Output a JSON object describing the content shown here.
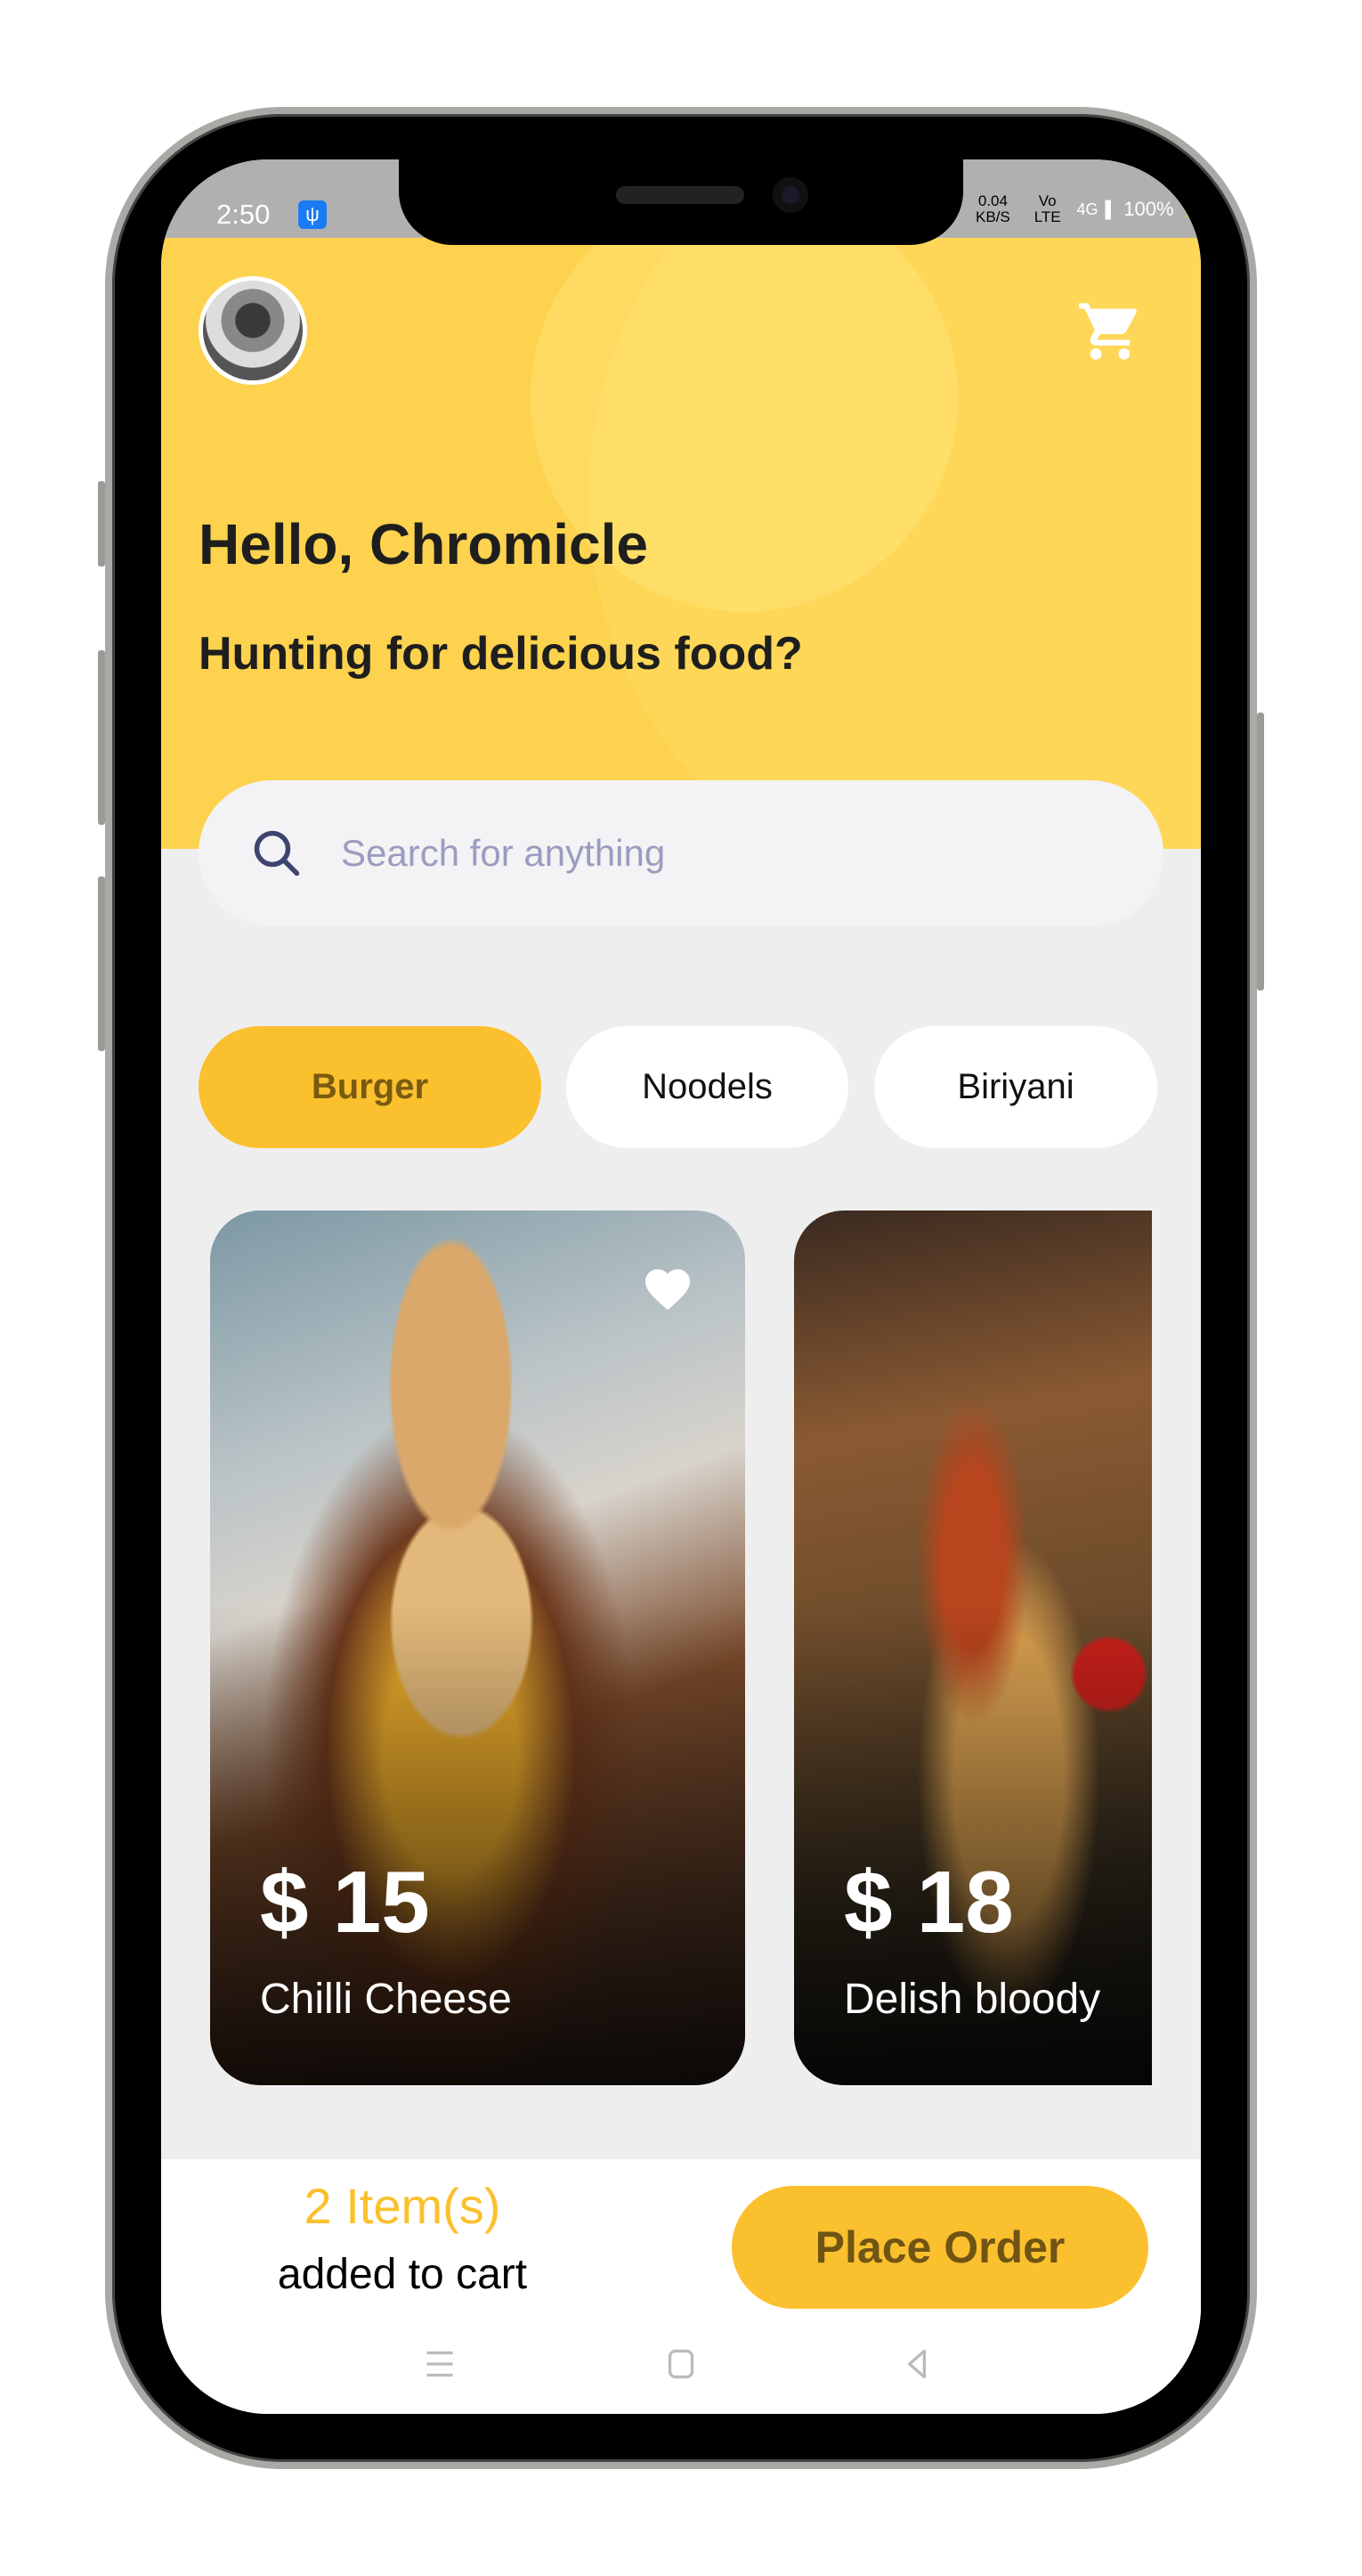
{
  "status_bar": {
    "time": "2:50",
    "usb_icon": "usb-icon",
    "net_speed": "0.04 KB/S",
    "volte": "Vo LTE",
    "network": "4G",
    "battery": "100%"
  },
  "header": {
    "greeting": "Hello, Chromicle",
    "subtitle": "Hunting for delicious food?"
  },
  "search": {
    "placeholder": "Search for anything",
    "value": ""
  },
  "categories": [
    {
      "label": "Burger",
      "active": true
    },
    {
      "label": "Noodels",
      "active": false
    },
    {
      "label": "Biriyani",
      "active": false
    }
  ],
  "foods": [
    {
      "price": "$ 15",
      "name": "Chilli Cheese",
      "favorite": true
    },
    {
      "price": "$ 18",
      "name": "Delish bloody"
    }
  ],
  "cart": {
    "count_label": "2 Item(s)",
    "added_label": "added to cart",
    "place_order": "Place Order"
  },
  "colors": {
    "accent": "#fbc02d",
    "header": "#fdd24e",
    "background": "#eeeeee"
  }
}
